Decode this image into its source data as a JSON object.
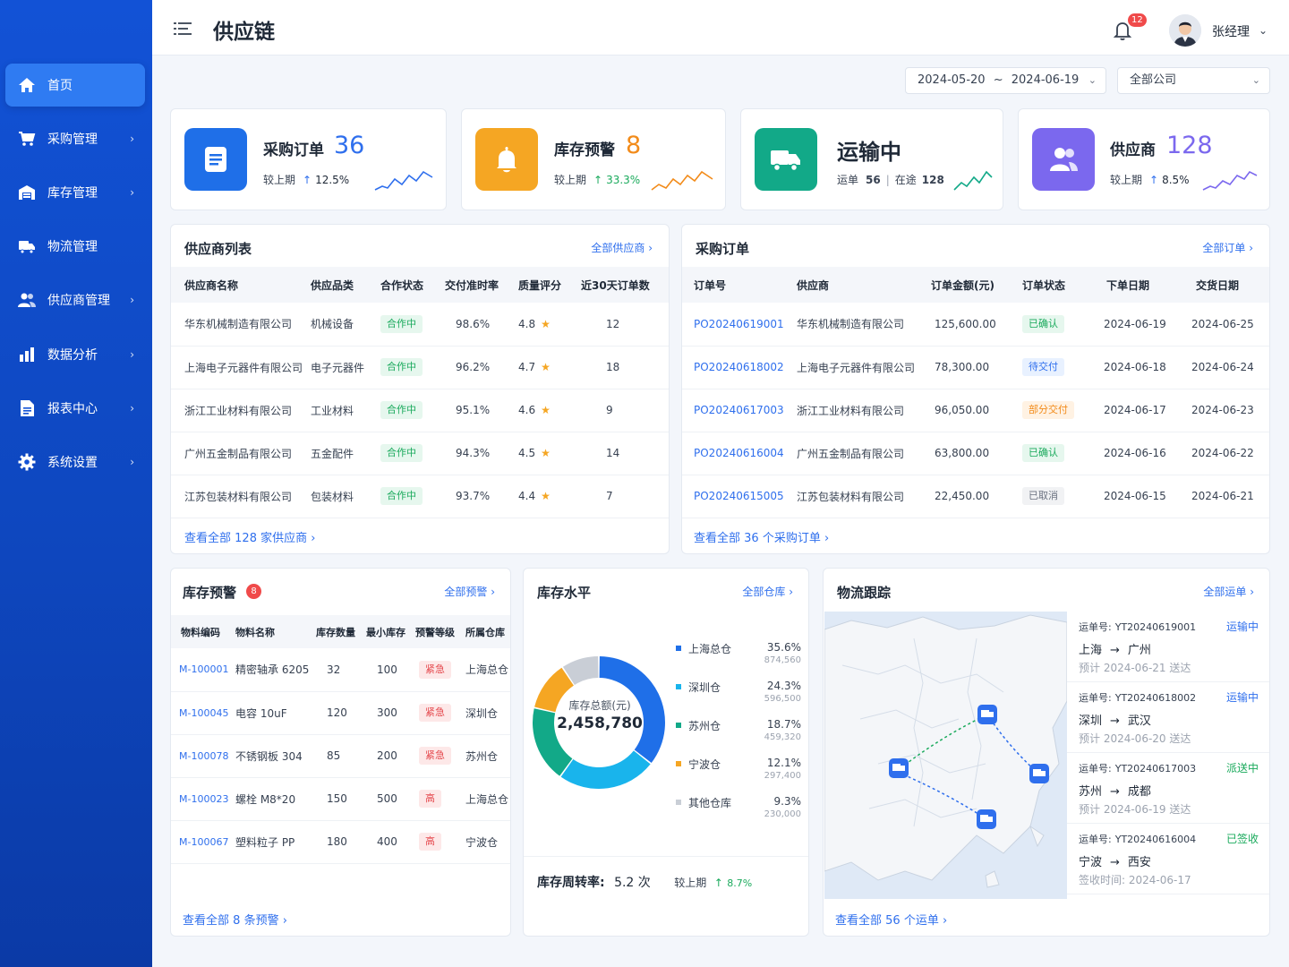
{
  "app": {
    "title": "供应链"
  },
  "sidebar": {
    "items": [
      {
        "label": "首页",
        "icon": "home-icon"
      },
      {
        "label": "采购管理",
        "icon": "cart-icon"
      },
      {
        "label": "库存管理",
        "icon": "warehouse-icon"
      },
      {
        "label": "物流管理",
        "icon": "truck-icon"
      },
      {
        "label": "供应商管理",
        "icon": "users-icon"
      },
      {
        "label": "数据分析",
        "icon": "bar-chart-icon"
      },
      {
        "label": "报表中心",
        "icon": "document-icon"
      },
      {
        "label": "系统设置",
        "icon": "gear-icon"
      }
    ]
  },
  "header": {
    "notification_count": "12",
    "user_name": "张经理"
  },
  "filters": {
    "date_start": "2024-05-20",
    "date_sep": "~",
    "date_end": "2024-06-19",
    "company": "全部公司"
  },
  "kpis": {
    "purchase": {
      "label": "采购订单",
      "value": "36",
      "compare": "较上期",
      "trend": "12.5%"
    },
    "stock_alert": {
      "label": "库存预警",
      "value": "8",
      "compare": "较上期",
      "trend": "33.3%"
    },
    "transport": {
      "label": "运输中",
      "waybill_label": "运单",
      "waybill_count": "56",
      "sep": "|",
      "transit_label": "在途",
      "transit_count": "128"
    },
    "supplier": {
      "label": "供应商",
      "value": "128",
      "compare": "较上期",
      "trend": "8.5%"
    }
  },
  "supplier_list": {
    "title": "供应商列表",
    "link": "全部供应商",
    "columns": [
      "供应商名称",
      "供应品类",
      "合作状态",
      "交付准时率",
      "质量评分",
      "近30天订单数"
    ],
    "rows": [
      {
        "name": "华东机械制造有限公司",
        "category": "机械设备",
        "status": "合作中",
        "ontime": "98.6%",
        "score": "4.8",
        "orders": "12"
      },
      {
        "name": "上海电子元器件有限公司",
        "category": "电子元器件",
        "status": "合作中",
        "ontime": "96.2%",
        "score": "4.7",
        "orders": "18"
      },
      {
        "name": "浙江工业材料有限公司",
        "category": "工业材料",
        "status": "合作中",
        "ontime": "95.1%",
        "score": "4.6",
        "orders": "9"
      },
      {
        "name": "广州五金制品有限公司",
        "category": "五金配件",
        "status": "合作中",
        "ontime": "94.3%",
        "score": "4.5",
        "orders": "14"
      },
      {
        "name": "江苏包装材料有限公司",
        "category": "包装材料",
        "status": "合作中",
        "ontime": "93.7%",
        "score": "4.4",
        "orders": "7"
      }
    ],
    "footer_pre": "查看全部",
    "footer_count": "128",
    "footer_post": "家供应商"
  },
  "purchase_orders": {
    "title": "采购订单",
    "link": "全部订单",
    "columns": [
      "订单号",
      "供应商",
      "订单金额(元)",
      "订单状态",
      "下单日期",
      "交货日期"
    ],
    "rows": [
      {
        "no": "PO20240619001",
        "supplier": "华东机械制造有限公司",
        "amount": "125,600.00",
        "status": "已确认",
        "color": "green",
        "order_date": "2024-06-19",
        "delivery": "2024-06-25"
      },
      {
        "no": "PO20240618002",
        "supplier": "上海电子元器件有限公司",
        "amount": "78,300.00",
        "status": "待交付",
        "color": "blue",
        "order_date": "2024-06-18",
        "delivery": "2024-06-24"
      },
      {
        "no": "PO20240617003",
        "supplier": "浙江工业材料有限公司",
        "amount": "96,050.00",
        "status": "部分交付",
        "color": "orange",
        "order_date": "2024-06-17",
        "delivery": "2024-06-23"
      },
      {
        "no": "PO20240616004",
        "supplier": "广州五金制品有限公司",
        "amount": "63,800.00",
        "status": "已确认",
        "color": "green",
        "order_date": "2024-06-16",
        "delivery": "2024-06-22"
      },
      {
        "no": "PO20240615005",
        "supplier": "江苏包装材料有限公司",
        "amount": "22,450.00",
        "status": "已取消",
        "color": "gray",
        "order_date": "2024-06-15",
        "delivery": "2024-06-21"
      }
    ],
    "footer_pre": "查看全部",
    "footer_count": "36",
    "footer_post": "个采购订单"
  },
  "stock_alerts": {
    "title": "库存预警",
    "badge": "8",
    "link": "全部预警",
    "columns": [
      "物料编码",
      "物料名称",
      "库存数量",
      "最小库存",
      "预警等级",
      "所属仓库"
    ],
    "rows": [
      {
        "code": "M-100001",
        "name": "精密轴承 6205",
        "qty": "32",
        "min": "100",
        "level": "紧急",
        "warehouse": "上海总仓"
      },
      {
        "code": "M-100045",
        "name": "电容 10uF",
        "qty": "120",
        "min": "300",
        "level": "紧急",
        "warehouse": "深圳仓"
      },
      {
        "code": "M-100078",
        "name": "不锈钢板 304",
        "qty": "85",
        "min": "200",
        "level": "紧急",
        "warehouse": "苏州仓"
      },
      {
        "code": "M-100023",
        "name": "螺栓 M8*20",
        "qty": "150",
        "min": "500",
        "level": "高",
        "warehouse": "上海总仓"
      },
      {
        "code": "M-100067",
        "name": "塑料粒子 PP",
        "qty": "180",
        "min": "400",
        "level": "高",
        "warehouse": "宁波仓"
      }
    ],
    "footer_pre": "查看全部",
    "footer_count": "8",
    "footer_post": "条预警"
  },
  "inventory": {
    "title": "库存水平",
    "link": "全部仓库",
    "center_label": "库存总额(元)",
    "center_value": "2,458,780",
    "turnover_label": "库存周转率:",
    "turnover_value": "5.2 次",
    "compare": "较上期",
    "trend": "8.7%"
  },
  "chart_data": {
    "type": "pie",
    "categories": [
      "上海总仓",
      "深圳仓",
      "苏州仓",
      "宁波仓",
      "其他仓库"
    ],
    "values": [
      35.6,
      24.3,
      18.7,
      12.1,
      9.3
    ],
    "amounts": [
      "874,560",
      "596,500",
      "459,320",
      "297,400",
      "230,000"
    ],
    "percents": [
      "35.6%",
      "24.3%",
      "18.7%",
      "12.1%",
      "9.3%"
    ],
    "colors": [
      "#1f6fe8",
      "#19b4ec",
      "#12a988",
      "#f5a623",
      "#c9ced6"
    ],
    "title": "",
    "donut": true
  },
  "logistics": {
    "title": "物流跟踪",
    "link": "全部运单",
    "shipments": [
      {
        "no_label": "运单号:",
        "no": "YT20240619001",
        "status": "运输中",
        "color": "#2f6fed",
        "from": "上海",
        "to": "广州",
        "eta": "预计 2024-06-21 送达"
      },
      {
        "no_label": "运单号:",
        "no": "YT20240618002",
        "status": "运输中",
        "color": "#2f6fed",
        "from": "深圳",
        "to": "武汉",
        "eta": "预计 2024-06-20 送达"
      },
      {
        "no_label": "运单号:",
        "no": "YT20240617003",
        "status": "派送中",
        "color": "#1aaa5c",
        "from": "苏州",
        "to": "成都",
        "eta": "预计 2024-06-19 送达"
      },
      {
        "no_label": "运单号:",
        "no": "YT20240616004",
        "status": "已签收",
        "color": "#1aaa5c",
        "from": "宁波",
        "to": "西安",
        "eta": "签收时间: 2024-06-17"
      }
    ],
    "footer_pre": "查看全部",
    "footer_count": "56",
    "footer_post": "个运单"
  },
  "colors": {
    "primary": "#2f6fed",
    "sidebar": "#1252d6",
    "orange": "#f5a623",
    "green": "#12a988",
    "purple": "#7b68ee"
  }
}
